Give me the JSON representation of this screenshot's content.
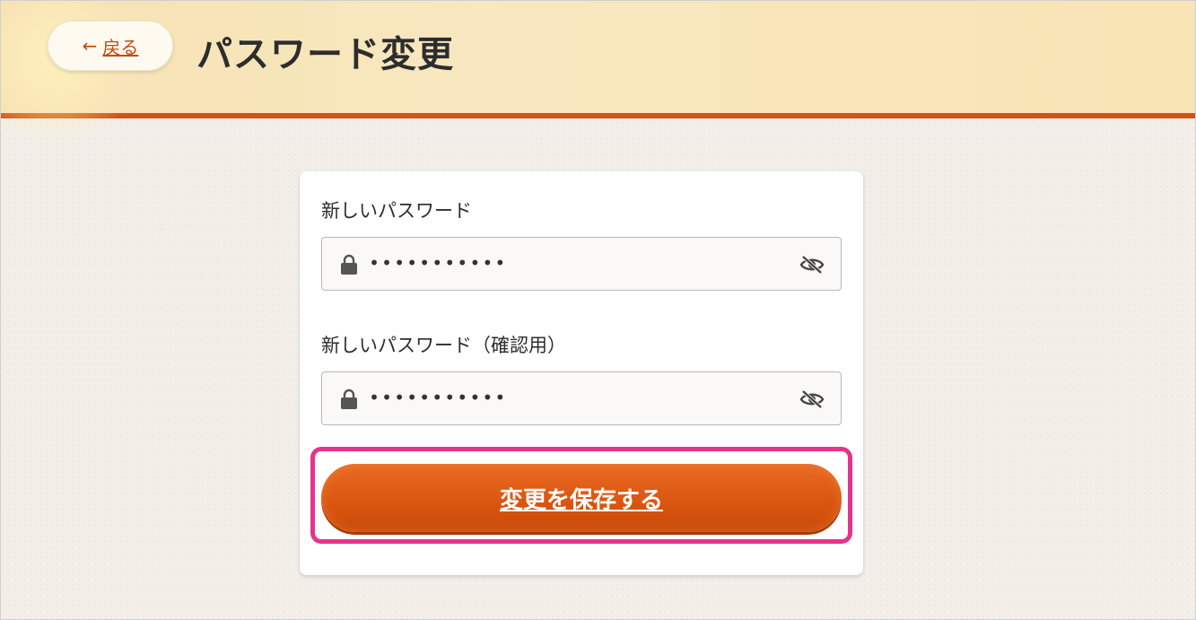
{
  "header": {
    "back_label": "戻る",
    "title": "パスワード変更"
  },
  "form": {
    "new_password": {
      "label": "新しいパスワード",
      "value_masked": "•••••••••••"
    },
    "confirm_password": {
      "label": "新しいパスワード（確認用）",
      "value_masked": "•••••••••••"
    },
    "save_label": "変更を保存する"
  },
  "colors": {
    "accent": "#d35410",
    "highlight": "#e8338a"
  },
  "icons": {
    "back": "arrow-left-icon",
    "lock": "lock-icon",
    "visibility": "eye-off-icon"
  }
}
